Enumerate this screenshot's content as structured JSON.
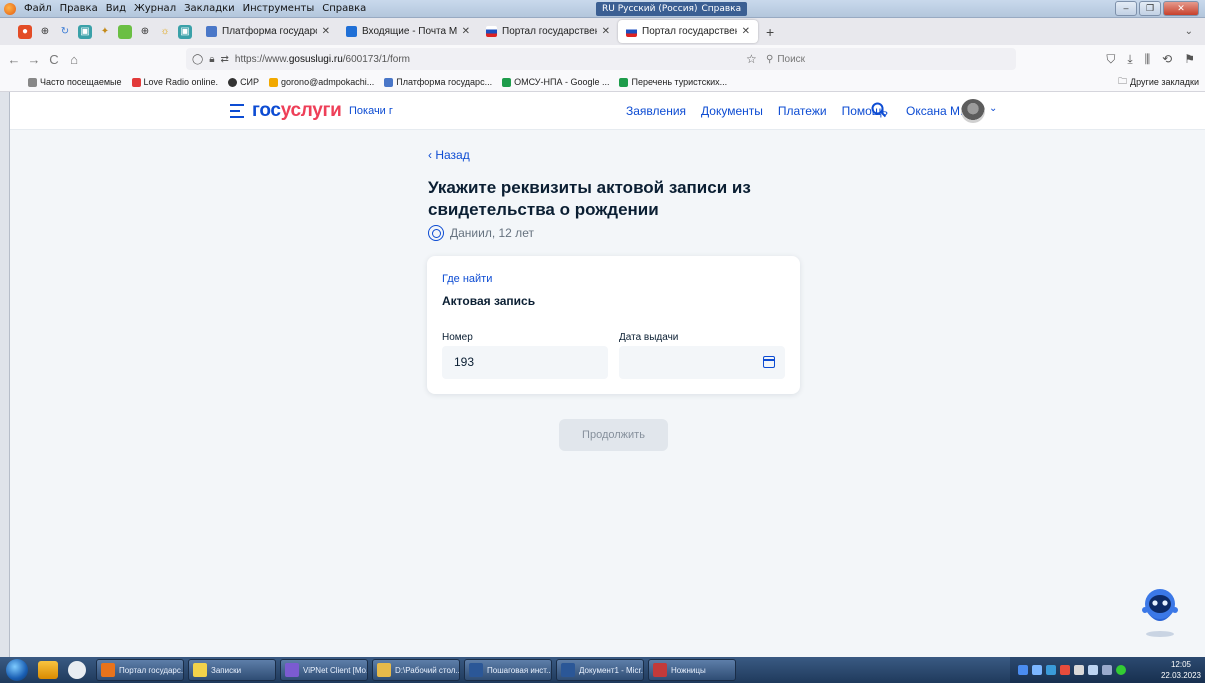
{
  "os_menu": {
    "items": [
      "Файл",
      "Правка",
      "Вид",
      "Журнал",
      "Закладки",
      "Инструменты",
      "Справка"
    ],
    "language_indicator": "RU Русский (Россия)",
    "help_label": "Справка"
  },
  "browser": {
    "tabs": [
      {
        "title": "Платформа государственны",
        "active": false
      },
      {
        "title": "Входящие - Почта Mail.ru",
        "active": false
      },
      {
        "title": "Портал государственных услу",
        "active": false
      },
      {
        "title": "Портал государственных услу",
        "active": true
      }
    ],
    "new_tab": "+",
    "url_prefix": "https://www.",
    "url_domain": "gosuslugi.ru",
    "url_path": "/600173/1/form",
    "search_placeholder": "Поиск",
    "bookmarks": [
      {
        "label": "Часто посещаемые",
        "color": "#888888"
      },
      {
        "label": "Love Radio online.",
        "color": "#e23a3a"
      },
      {
        "label": "СИР",
        "color": "#333333"
      },
      {
        "label": "gorono@admpokachi...",
        "color": "#f2a900"
      },
      {
        "label": "Платформа государс...",
        "color": "#4a77c8"
      },
      {
        "label": "ОМСУ-НПА - Google ...",
        "color": "#1e9c4b"
      },
      {
        "label": "Перечень туристских...",
        "color": "#1e9c4b"
      }
    ],
    "other_bookmarks": "Другие закладки"
  },
  "header": {
    "logo_part1": "гос",
    "logo_part2": "услуги",
    "region": "Покачи г",
    "nav": [
      "Заявления",
      "Документы",
      "Платежи",
      "Помощь"
    ],
    "user_name": "Оксана М."
  },
  "form": {
    "back_label": "‹ Назад",
    "title": "Укажите реквизиты актовой записи из свидетельства о рождении",
    "child": "Даниил, 12 лет",
    "where_to_find": "Где найти",
    "section_title": "Актовая запись",
    "number_label": "Номер",
    "number_value": "193",
    "date_label": "Дата выдачи",
    "date_value": "",
    "continue_label": "Продолжить"
  },
  "taskbar": {
    "buttons": [
      {
        "label": "Портал государс...",
        "color": "#e8731c"
      },
      {
        "label": "Записки",
        "color": "#f2d24a"
      },
      {
        "label": "ViPNet Client [Mo...",
        "color": "#7b5bd1"
      },
      {
        "label": "D:\\Рабочий стол...",
        "color": "#e6b94a"
      },
      {
        "label": "Пошаговая инст...",
        "color": "#2b5797"
      },
      {
        "label": "Документ1 - Micr...",
        "color": "#2b5797"
      },
      {
        "label": "Ножницы",
        "color": "#c23a3a"
      }
    ],
    "time": "12:05",
    "date": "22.03.2023"
  }
}
